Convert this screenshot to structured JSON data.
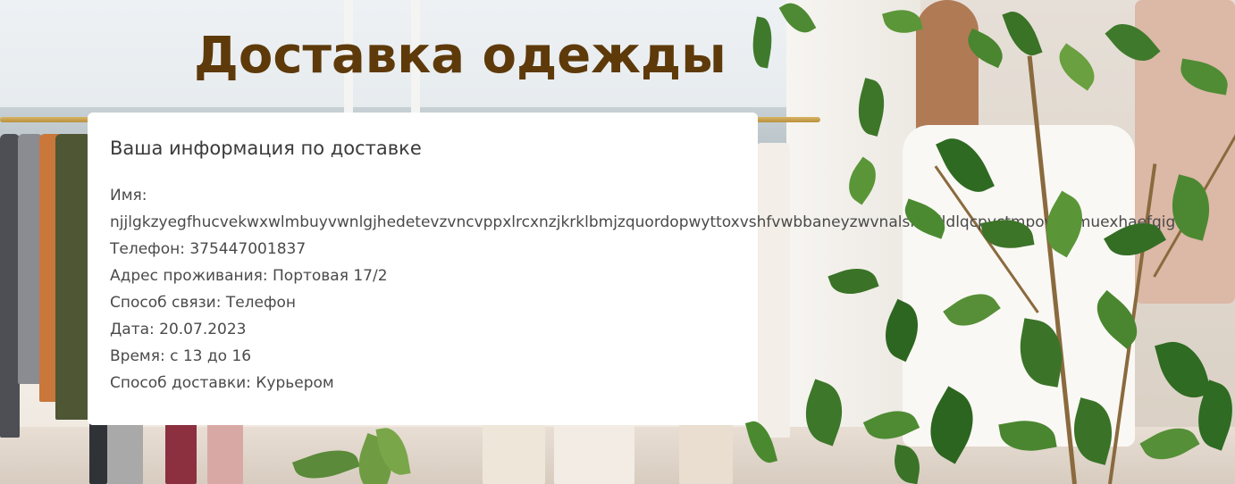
{
  "page": {
    "title": "Доставка одежды"
  },
  "card": {
    "heading": "Ваша информация по доставке",
    "name_label": "Имя:",
    "name_value": "njjlgkzyegfhucvekwxwlmbuyvwnlgjhedetevzvncvppxlrcxnzjkrklbmjzquordopwyttoxvshfvwbbaneyzwvnalslhailldlqcpvctmpowpemuexhaefqig",
    "phone": "Телефон: 375447001837",
    "address": "Адрес проживания: Портовая 17/2",
    "contact_method": "Способ связи: Телефон",
    "date": "Дата: 20.07.2023",
    "time": "Время: с 13 до 16",
    "delivery_method": "Способ доставки: Курьером"
  },
  "colors": {
    "title": "#5e3a0a",
    "card_background": "#ffffff",
    "text": "#4a4a4a"
  },
  "background": {
    "subject": "clothing-store-photo"
  }
}
